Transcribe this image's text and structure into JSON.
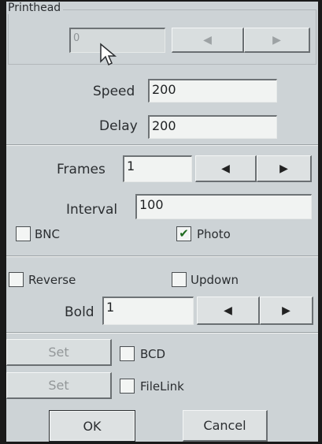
{
  "printhead": {
    "group_label": "Printhead",
    "value": "0",
    "left_arrow": "◀",
    "right_arrow": "▶"
  },
  "speed": {
    "label": "Speed",
    "value": "200"
  },
  "delay": {
    "label": "Delay",
    "value": "200"
  },
  "frames": {
    "label": "Frames",
    "value": "1",
    "left_arrow": "◀",
    "right_arrow": "▶"
  },
  "interval": {
    "label": "Interval",
    "value": "100"
  },
  "bnc": {
    "label": "BNC",
    "checked": false
  },
  "photo": {
    "label": "Photo",
    "checked": true,
    "check_glyph": "✔"
  },
  "reverse": {
    "label": "Reverse",
    "checked": false
  },
  "updown": {
    "label": "Updown",
    "checked": false
  },
  "bold": {
    "label": "Bold",
    "value": "1",
    "left_arrow": "◀",
    "right_arrow": "▶"
  },
  "set1": {
    "label": "Set"
  },
  "bcd": {
    "label": "BCD",
    "checked": false
  },
  "set2": {
    "label": "Set"
  },
  "filelink": {
    "label": "FileLink",
    "checked": false
  },
  "ok": {
    "label": "OK"
  },
  "cancel": {
    "label": "Cancel"
  },
  "colors": {
    "panel": "#cdd3d6",
    "check": "#1f6b1f"
  }
}
